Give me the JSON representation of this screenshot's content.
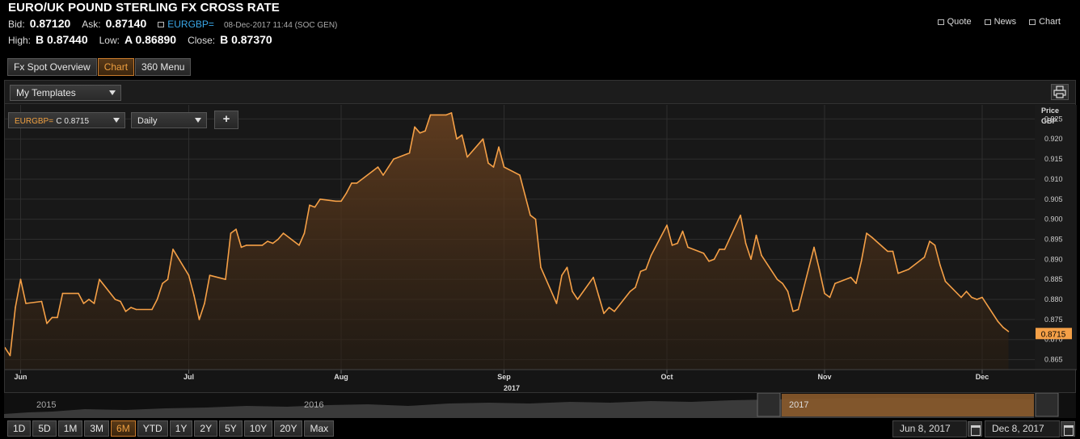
{
  "header": {
    "title": "EURO/UK POUND STERLING FX CROSS RATE",
    "bid_label": "Bid:",
    "bid": "0.87120",
    "ask_label": "Ask:",
    "ask": "0.87140",
    "ric": "EURGBP=",
    "timestamp": "08-Dec-2017 11:44 (SOC GEN)",
    "high_label": "High:",
    "high": "B 0.87440",
    "low_label": "Low:",
    "low": "A 0.86890",
    "close_label": "Close:",
    "close": "B 0.87370",
    "links": {
      "quote": "Quote",
      "news": "News",
      "chart": "Chart"
    }
  },
  "tabs": [
    {
      "label": "Fx Spot Overview",
      "active": false
    },
    {
      "label": "Chart",
      "active": true
    },
    {
      "label": "360 Menu",
      "active": false
    }
  ],
  "toolbar": {
    "templates": "My Templates",
    "instrument_ric": "EURGBP=",
    "instrument_value": "C 0.8715",
    "interval": "Daily",
    "add": "+"
  },
  "navigator": {
    "years": [
      "2015",
      "2016",
      "2017"
    ]
  },
  "ranges": [
    {
      "label": "1D",
      "active": false
    },
    {
      "label": "5D",
      "active": false
    },
    {
      "label": "1M",
      "active": false
    },
    {
      "label": "3M",
      "active": false
    },
    {
      "label": "6M",
      "active": true
    },
    {
      "label": "YTD",
      "active": false
    },
    {
      "label": "1Y",
      "active": false
    },
    {
      "label": "2Y",
      "active": false
    },
    {
      "label": "5Y",
      "active": false
    },
    {
      "label": "10Y",
      "active": false
    },
    {
      "label": "20Y",
      "active": false
    },
    {
      "label": "Max",
      "active": false
    }
  ],
  "date_range": {
    "start": "Jun 8, 2017",
    "end": "Dec 8, 2017"
  },
  "colors": {
    "line": "#f5a047",
    "accent": "#f0a040",
    "ric": "#3aa7e8",
    "last_price_tag": "#f5a047"
  },
  "chart_data": {
    "type": "area",
    "title": "",
    "axis_title": [
      "Price",
      "GBP"
    ],
    "ylim": [
      0.8625,
      0.9285
    ],
    "yticks": [
      0.865,
      0.87,
      0.875,
      0.88,
      0.885,
      0.89,
      0.895,
      0.9,
      0.905,
      0.91,
      0.915,
      0.92,
      0.925
    ],
    "ytick_labels": [
      "0.865",
      "0.870",
      "0.875",
      "0.880",
      "0.885",
      "0.890",
      "0.895",
      "0.900",
      "0.905",
      "0.910",
      "0.915",
      "0.920",
      "0.925"
    ],
    "xlim": [
      "2017-05-29",
      "2017-12-11"
    ],
    "xtick_labels": [
      {
        "date": "2017-06-01",
        "label": "Jun"
      },
      {
        "date": "2017-07-03",
        "label": "Jul"
      },
      {
        "date": "2017-08-01",
        "label": "Aug"
      },
      {
        "date": "2017-09-01",
        "label": "Sep"
      },
      {
        "date": "2017-10-02",
        "label": "Oct"
      },
      {
        "date": "2017-11-01",
        "label": "Nov"
      },
      {
        "date": "2017-12-01",
        "label": "Dec"
      }
    ],
    "year_label": "2017",
    "last_price": "0.8715",
    "grid": true,
    "series": [
      {
        "color": "#f5a047",
        "points": [
          [
            "2017-05-29",
            0.868
          ],
          [
            "2017-05-30",
            0.866
          ],
          [
            "2017-05-31",
            0.878
          ],
          [
            "2017-06-01",
            0.885
          ],
          [
            "2017-06-02",
            0.879
          ],
          [
            "2017-06-05",
            0.8795
          ],
          [
            "2017-06-06",
            0.874
          ],
          [
            "2017-06-07",
            0.8755
          ],
          [
            "2017-06-08",
            0.8755
          ],
          [
            "2017-06-09",
            0.8815
          ],
          [
            "2017-06-12",
            0.8815
          ],
          [
            "2017-06-13",
            0.879
          ],
          [
            "2017-06-14",
            0.88
          ],
          [
            "2017-06-15",
            0.879
          ],
          [
            "2017-06-16",
            0.885
          ],
          [
            "2017-06-19",
            0.88
          ],
          [
            "2017-06-20",
            0.8795
          ],
          [
            "2017-06-21",
            0.877
          ],
          [
            "2017-06-22",
            0.878
          ],
          [
            "2017-06-23",
            0.8775
          ],
          [
            "2017-06-26",
            0.8775
          ],
          [
            "2017-06-27",
            0.88
          ],
          [
            "2017-06-28",
            0.884
          ],
          [
            "2017-06-29",
            0.885
          ],
          [
            "2017-06-30",
            0.8925
          ],
          [
            "2017-07-03",
            0.886
          ],
          [
            "2017-07-04",
            0.881
          ],
          [
            "2017-07-05",
            0.875
          ],
          [
            "2017-07-06",
            0.879
          ],
          [
            "2017-07-07",
            0.886
          ],
          [
            "2017-07-10",
            0.885
          ],
          [
            "2017-07-11",
            0.8965
          ],
          [
            "2017-07-12",
            0.8975
          ],
          [
            "2017-07-13",
            0.893
          ],
          [
            "2017-07-14",
            0.8935
          ],
          [
            "2017-07-17",
            0.8935
          ],
          [
            "2017-07-18",
            0.8945
          ],
          [
            "2017-07-19",
            0.894
          ],
          [
            "2017-07-20",
            0.895
          ],
          [
            "2017-07-21",
            0.8965
          ],
          [
            "2017-07-24",
            0.8935
          ],
          [
            "2017-07-25",
            0.8965
          ],
          [
            "2017-07-26",
            0.9035
          ],
          [
            "2017-07-27",
            0.903
          ],
          [
            "2017-07-28",
            0.905
          ],
          [
            "2017-07-31",
            0.9045
          ],
          [
            "2017-08-01",
            0.9045
          ],
          [
            "2017-08-02",
            0.9065
          ],
          [
            "2017-08-03",
            0.909
          ],
          [
            "2017-08-04",
            0.909
          ],
          [
            "2017-08-07",
            0.912
          ],
          [
            "2017-08-08",
            0.913
          ],
          [
            "2017-08-09",
            0.911
          ],
          [
            "2017-08-10",
            0.913
          ],
          [
            "2017-08-11",
            0.915
          ],
          [
            "2017-08-14",
            0.9165
          ],
          [
            "2017-08-15",
            0.923
          ],
          [
            "2017-08-16",
            0.9215
          ],
          [
            "2017-08-17",
            0.922
          ],
          [
            "2017-08-18",
            0.926
          ],
          [
            "2017-08-21",
            0.926
          ],
          [
            "2017-08-22",
            0.9265
          ],
          [
            "2017-08-23",
            0.92
          ],
          [
            "2017-08-24",
            0.921
          ],
          [
            "2017-08-25",
            0.9155
          ],
          [
            "2017-08-28",
            0.92
          ],
          [
            "2017-08-29",
            0.914
          ],
          [
            "2017-08-30",
            0.913
          ],
          [
            "2017-08-31",
            0.918
          ],
          [
            "2017-09-01",
            0.913
          ],
          [
            "2017-09-04",
            0.911
          ],
          [
            "2017-09-05",
            0.906
          ],
          [
            "2017-09-06",
            0.901
          ],
          [
            "2017-09-07",
            0.9
          ],
          [
            "2017-09-08",
            0.888
          ],
          [
            "2017-09-11",
            0.879
          ],
          [
            "2017-09-12",
            0.886
          ],
          [
            "2017-09-13",
            0.888
          ],
          [
            "2017-09-14",
            0.882
          ],
          [
            "2017-09-15",
            0.88
          ],
          [
            "2017-09-18",
            0.8855
          ],
          [
            "2017-09-19",
            0.881
          ],
          [
            "2017-09-20",
            0.8765
          ],
          [
            "2017-09-21",
            0.878
          ],
          [
            "2017-09-22",
            0.877
          ],
          [
            "2017-09-25",
            0.882
          ],
          [
            "2017-09-26",
            0.883
          ],
          [
            "2017-09-27",
            0.887
          ],
          [
            "2017-09-28",
            0.8875
          ],
          [
            "2017-09-29",
            0.891
          ],
          [
            "2017-10-02",
            0.8985
          ],
          [
            "2017-10-03",
            0.8935
          ],
          [
            "2017-10-04",
            0.894
          ],
          [
            "2017-10-05",
            0.897
          ],
          [
            "2017-10-06",
            0.893
          ],
          [
            "2017-10-09",
            0.8915
          ],
          [
            "2017-10-10",
            0.8895
          ],
          [
            "2017-10-11",
            0.89
          ],
          [
            "2017-10-12",
            0.8925
          ],
          [
            "2017-10-13",
            0.8925
          ],
          [
            "2017-10-16",
            0.901
          ],
          [
            "2017-10-17",
            0.894
          ],
          [
            "2017-10-18",
            0.89
          ],
          [
            "2017-10-19",
            0.896
          ],
          [
            "2017-10-20",
            0.891
          ],
          [
            "2017-10-23",
            0.885
          ],
          [
            "2017-10-24",
            0.884
          ],
          [
            "2017-10-25",
            0.882
          ],
          [
            "2017-10-26",
            0.877
          ],
          [
            "2017-10-27",
            0.8775
          ],
          [
            "2017-10-30",
            0.893
          ],
          [
            "2017-10-31",
            0.8875
          ],
          [
            "2017-11-01",
            0.8815
          ],
          [
            "2017-11-02",
            0.8805
          ],
          [
            "2017-11-03",
            0.884
          ],
          [
            "2017-11-06",
            0.8855
          ],
          [
            "2017-11-07",
            0.884
          ],
          [
            "2017-11-08",
            0.8895
          ],
          [
            "2017-11-09",
            0.8965
          ],
          [
            "2017-11-10",
            0.8955
          ],
          [
            "2017-11-13",
            0.892
          ],
          [
            "2017-11-14",
            0.892
          ],
          [
            "2017-11-15",
            0.8865
          ],
          [
            "2017-11-16",
            0.887
          ],
          [
            "2017-11-17",
            0.8875
          ],
          [
            "2017-11-20",
            0.8905
          ],
          [
            "2017-11-21",
            0.8945
          ],
          [
            "2017-11-22",
            0.8935
          ],
          [
            "2017-11-23",
            0.8885
          ],
          [
            "2017-11-24",
            0.8845
          ],
          [
            "2017-11-27",
            0.8805
          ],
          [
            "2017-11-28",
            0.882
          ],
          [
            "2017-11-29",
            0.8805
          ],
          [
            "2017-11-30",
            0.88
          ],
          [
            "2017-12-01",
            0.8805
          ],
          [
            "2017-12-04",
            0.8745
          ],
          [
            "2017-12-05",
            0.873
          ],
          [
            "2017-12-06",
            0.872
          ]
        ]
      }
    ]
  }
}
